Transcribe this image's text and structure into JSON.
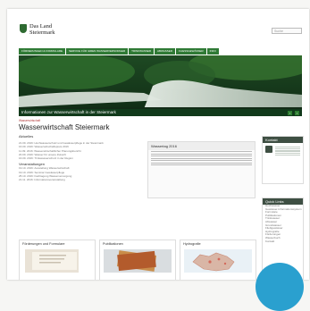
{
  "brand": {
    "line1": "Das Land",
    "line2": "Steiermark"
  },
  "search": {
    "label": "Suche"
  },
  "nav": [
    "FÖRDERUNGEN & FORMULARE",
    "SERVICE FÜR IHREN WASSERVERSORGER",
    "TRINKWASSER",
    "ABWASSER",
    "FLIESSGEWÄSSER",
    "INFO"
  ],
  "hero": {
    "caption": "Informationen zur Wasserwirtschaft in der Steiermark"
  },
  "page": {
    "breadcrumb": "Wasserwirtschaft",
    "title": "Wasserwirtschaft Steiermark"
  },
  "aktuelles": {
    "title": "Aktuelles",
    "items": [
      "21.09. 2016: Hochwasserschutz und Gewässerpflege in der Steiermark",
      "16.09. 2016: Wasserwirtschaftspreis 2016",
      "11.09. 2016: Wasserwirtschaftlicher Planungsbericht",
      "20.09. 2016: Wasser für unsere Zukunft",
      "16.09. 2016: Trinkwasserschutz in der Region"
    ]
  },
  "veranstaltungen": {
    "title": "Veranstaltungen",
    "items": [
      "19.10. 2016: Ausstellung Wasserwirtschaft",
      "19.10. 2016: Seminar Gewässerpflege",
      "25.10. 2016: Fachtagung Wasserversorgung",
      "21.11. 2016: Informationsveranstaltung"
    ]
  },
  "wassertag": {
    "title": "Wassertag 2016"
  },
  "cards": [
    {
      "title": "Förderungen und Formulare"
    },
    {
      "title": "Publikationen"
    },
    {
      "title": "Hydrografie"
    }
  ],
  "kontakt": {
    "title": "Kontakt"
  },
  "quicklinks": {
    "title": "Quick Links",
    "items": [
      "Hochwasser",
      "Gewässer-Informationssystem",
      "Formulare",
      "Publikationen",
      "Trinkwasser",
      "Abwasser",
      "Grundwasser",
      "Fließgewässer",
      "Hydrografie",
      "Förderungen",
      "Wasserbuch",
      "Kontakt"
    ]
  }
}
